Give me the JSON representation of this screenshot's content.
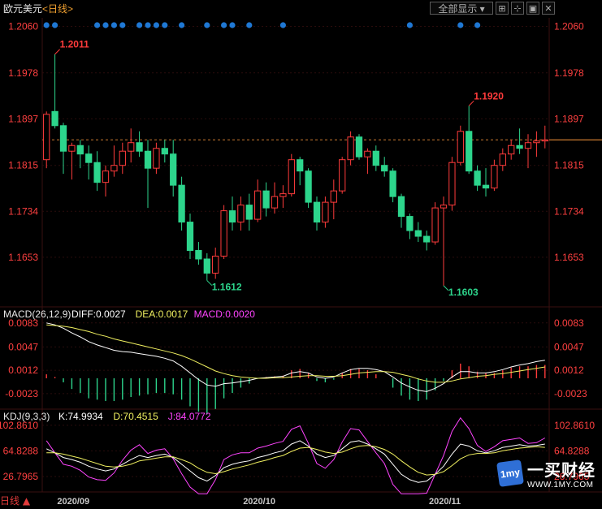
{
  "header": {
    "symbol": "欧元美元",
    "period": "<日线>",
    "period_button": "全部显示",
    "toolbar_icons": [
      "zoom-fit-icon",
      "crosshair-icon",
      "window-icon",
      "close-icon"
    ]
  },
  "corner_label": "日线",
  "watermark": {
    "brand_cn": "一买财经",
    "brand_en": "WWW.1MY.COM",
    "logo_text": "1my"
  },
  "colors": {
    "up": "#ff3b3b",
    "down": "#2dd58c",
    "grid": "#3a1010",
    "axis_text": "#ff4040",
    "diff_line": "#ffffff",
    "dea_line": "#f0f060",
    "macd_text": "#ff44ff",
    "dot": "#1f78d4",
    "price_line": "#ff9a3c"
  },
  "chart_data": [
    {
      "type": "candlestick",
      "panel": "price",
      "y_ticks": [
        "1.2060",
        "1.1978",
        "1.1897",
        "1.1815",
        "1.1734",
        "1.1653"
      ],
      "ylim": [
        1.1567,
        1.2075
      ],
      "x_tick_labels": [
        {
          "label": "2020/09",
          "index": 3
        },
        {
          "label": "2020/10",
          "index": 25
        },
        {
          "label": "2020/11",
          "index": 47
        }
      ],
      "current_price": 1.186,
      "annotations": [
        {
          "text": "1.2011",
          "index": 1,
          "value": 1.2011,
          "color": "up"
        },
        {
          "text": "1.1612",
          "index": 19,
          "value": 1.1612,
          "color": "down"
        },
        {
          "text": "1.1920",
          "index": 50,
          "value": 1.192,
          "color": "up"
        },
        {
          "text": "1.1603",
          "index": 47,
          "value": 1.1603,
          "color": "down"
        }
      ],
      "signal_dot_indices": [
        0,
        1,
        6,
        7,
        8,
        9,
        11,
        12,
        13,
        14,
        16,
        19,
        21,
        22,
        24,
        28,
        43,
        49,
        51
      ],
      "ohlc": [
        [
          1.1825,
          1.191,
          1.181,
          1.1905
        ],
        [
          1.191,
          1.2011,
          1.188,
          1.1885
        ],
        [
          1.1885,
          1.189,
          1.18,
          1.184
        ],
        [
          1.184,
          1.1855,
          1.179,
          1.185
        ],
        [
          1.185,
          1.186,
          1.181,
          1.1835
        ],
        [
          1.1835,
          1.185,
          1.179,
          1.182
        ],
        [
          1.182,
          1.184,
          1.177,
          1.1785
        ],
        [
          1.1785,
          1.1815,
          1.176,
          1.1805
        ],
        [
          1.1805,
          1.185,
          1.1795,
          1.1815
        ],
        [
          1.1815,
          1.1855,
          1.18,
          1.184
        ],
        [
          1.184,
          1.188,
          1.182,
          1.1855
        ],
        [
          1.1855,
          1.1875,
          1.183,
          1.184
        ],
        [
          1.184,
          1.186,
          1.174,
          1.181
        ],
        [
          1.181,
          1.1855,
          1.18,
          1.1845
        ],
        [
          1.1845,
          1.186,
          1.182,
          1.1835
        ],
        [
          1.1835,
          1.186,
          1.176,
          1.178
        ],
        [
          1.178,
          1.1795,
          1.17,
          1.1715
        ],
        [
          1.1715,
          1.173,
          1.165,
          1.1665
        ],
        [
          1.1665,
          1.168,
          1.164,
          1.165
        ],
        [
          1.165,
          1.166,
          1.1612,
          1.1625
        ],
        [
          1.1625,
          1.167,
          1.1615,
          1.1655
        ],
        [
          1.1655,
          1.1745,
          1.165,
          1.1735
        ],
        [
          1.1735,
          1.176,
          1.17,
          1.1715
        ],
        [
          1.1715,
          1.176,
          1.17,
          1.1745
        ],
        [
          1.1745,
          1.1765,
          1.17,
          1.172
        ],
        [
          1.172,
          1.179,
          1.1715,
          1.177
        ],
        [
          1.177,
          1.1785,
          1.1725,
          1.174
        ],
        [
          1.174,
          1.1785,
          1.173,
          1.176
        ],
        [
          1.176,
          1.178,
          1.174,
          1.1765
        ],
        [
          1.1765,
          1.1835,
          1.176,
          1.1825
        ],
        [
          1.1825,
          1.183,
          1.178,
          1.1805
        ],
        [
          1.1805,
          1.181,
          1.174,
          1.175
        ],
        [
          1.175,
          1.176,
          1.17,
          1.1715
        ],
        [
          1.1715,
          1.176,
          1.1705,
          1.175
        ],
        [
          1.175,
          1.179,
          1.172,
          1.177
        ],
        [
          1.177,
          1.183,
          1.1765,
          1.1825
        ],
        [
          1.1825,
          1.1875,
          1.1815,
          1.1865
        ],
        [
          1.1865,
          1.187,
          1.1825,
          1.183
        ],
        [
          1.183,
          1.1845,
          1.18,
          1.184
        ],
        [
          1.184,
          1.185,
          1.1805,
          1.1815
        ],
        [
          1.1815,
          1.183,
          1.1795,
          1.1805
        ],
        [
          1.1805,
          1.181,
          1.175,
          1.176
        ],
        [
          1.176,
          1.1765,
          1.1705,
          1.1725
        ],
        [
          1.1725,
          1.173,
          1.1685,
          1.17
        ],
        [
          1.17,
          1.1715,
          1.168,
          1.169
        ],
        [
          1.169,
          1.17,
          1.1665,
          1.168
        ],
        [
          1.168,
          1.175,
          1.1675,
          1.174
        ],
        [
          1.174,
          1.176,
          1.1603,
          1.1745
        ],
        [
          1.1745,
          1.183,
          1.1735,
          1.182
        ],
        [
          1.182,
          1.1885,
          1.1815,
          1.1875
        ],
        [
          1.1875,
          1.192,
          1.18,
          1.1805
        ],
        [
          1.1805,
          1.1815,
          1.177,
          1.178
        ],
        [
          1.178,
          1.181,
          1.176,
          1.1775
        ],
        [
          1.1775,
          1.1825,
          1.177,
          1.1815
        ],
        [
          1.1815,
          1.1845,
          1.1805,
          1.1835
        ],
        [
          1.1835,
          1.186,
          1.1825,
          1.185
        ],
        [
          1.185,
          1.188,
          1.1835,
          1.1845
        ],
        [
          1.1845,
          1.187,
          1.181,
          1.1855
        ],
        [
          1.1855,
          1.1875,
          1.183,
          1.1858
        ],
        [
          1.1858,
          1.1885,
          1.1845,
          1.186
        ]
      ]
    },
    {
      "type": "line",
      "panel": "macd",
      "title": "MACD(26,12,9)",
      "readouts": [
        {
          "label": "DIFF:0.0027",
          "color": "diff_line"
        },
        {
          "label": "DEA:0.0017",
          "color": "dea_line"
        },
        {
          "label": "MACD:0.0020",
          "color": "macd_text"
        }
      ],
      "y_ticks": [
        "0.0083",
        "0.0047",
        "0.0012",
        "-0.0023"
      ],
      "ylim": [
        -0.0045,
        0.009
      ],
      "diff": [
        0.0083,
        0.008,
        0.0075,
        0.0068,
        0.0062,
        0.0055,
        0.005,
        0.0046,
        0.0042,
        0.004,
        0.0039,
        0.0037,
        0.0035,
        0.0033,
        0.003,
        0.0026,
        0.0018,
        0.0008,
        -0.0002,
        -0.001,
        -0.0012,
        -0.0008,
        -0.0007,
        -0.0005,
        -0.0003,
        0.0,
        0.0001,
        0.0002,
        0.0003,
        0.0008,
        0.001,
        0.0008,
        0.0002,
        0.0,
        0.0002,
        0.0008,
        0.0013,
        0.0015,
        0.0015,
        0.0013,
        0.001,
        0.0002,
        -0.0007,
        -0.0013,
        -0.0018,
        -0.002,
        -0.0015,
        -0.0008,
        0.0002,
        0.001,
        0.001,
        0.0008,
        0.0008,
        0.001,
        0.0013,
        0.0017,
        0.002,
        0.0022,
        0.0025,
        0.0027
      ],
      "dea": [
        0.008,
        0.0079,
        0.0078,
        0.0076,
        0.0073,
        0.007,
        0.0066,
        0.0063,
        0.0059,
        0.0056,
        0.0053,
        0.005,
        0.0047,
        0.0044,
        0.0041,
        0.0038,
        0.0034,
        0.0029,
        0.0023,
        0.0017,
        0.0011,
        0.0007,
        0.0004,
        0.0002,
        0.0001,
        0.0,
        0.0,
        0.0001,
        0.0001,
        0.0002,
        0.0003,
        0.0004,
        0.0004,
        0.0003,
        0.0003,
        0.0004,
        0.0006,
        0.0008,
        0.0009,
        0.001,
        0.001,
        0.0009,
        0.0006,
        0.0003,
        -0.0001,
        -0.0004,
        -0.0006,
        -0.0006,
        -0.0004,
        -0.0001,
        0.0001,
        0.0003,
        0.0004,
        0.0006,
        0.0007,
        0.0009,
        0.0011,
        0.0013,
        0.0015,
        0.0017
      ],
      "histogram": [
        0.0006,
        0.0002,
        -0.0006,
        -0.0016,
        -0.0022,
        -0.003,
        -0.0032,
        -0.0034,
        -0.0034,
        -0.0032,
        -0.0028,
        -0.0026,
        -0.0024,
        -0.0022,
        -0.0022,
        -0.0024,
        -0.0032,
        -0.0042,
        -0.005,
        -0.0054,
        -0.0046,
        -0.003,
        -0.0022,
        -0.0014,
        -0.0008,
        -0.0001,
        0.0002,
        0.0003,
        0.0004,
        0.0012,
        0.0014,
        0.0008,
        -0.0004,
        -0.0006,
        -0.0002,
        0.0008,
        0.0014,
        0.0014,
        0.0012,
        0.0006,
        0.0,
        -0.0014,
        -0.0026,
        -0.0032,
        -0.0034,
        -0.0032,
        -0.0018,
        -0.0004,
        0.0012,
        0.0022,
        0.0018,
        0.001,
        0.0008,
        0.0008,
        0.0012,
        0.0016,
        0.0018,
        0.0018,
        0.002,
        0.002
      ]
    },
    {
      "type": "line",
      "panel": "kdj",
      "title": "KDJ(9,3,3)",
      "readouts": [
        {
          "label": "K:74.9934",
          "color": "diff_line"
        },
        {
          "label": "D:70.4515",
          "color": "dea_line"
        },
        {
          "label": "J:84.0772",
          "color": "macd_text"
        }
      ],
      "y_ticks": [
        "102.8610",
        "64.8288",
        "26.7965"
      ],
      "ylim": [
        5,
        110
      ],
      "k": [
        68,
        62,
        55,
        52,
        48,
        42,
        38,
        35,
        38,
        45,
        52,
        58,
        55,
        58,
        60,
        55,
        45,
        35,
        25,
        20,
        28,
        40,
        45,
        48,
        50,
        55,
        58,
        62,
        65,
        75,
        80,
        72,
        60,
        55,
        58,
        68,
        78,
        80,
        75,
        68,
        60,
        45,
        30,
        22,
        18,
        20,
        30,
        42,
        60,
        75,
        72,
        65,
        62,
        65,
        70,
        72,
        74,
        72,
        73,
        75
      ],
      "d": [
        62,
        62,
        60,
        57,
        54,
        50,
        46,
        42,
        41,
        42,
        45,
        50,
        52,
        54,
        56,
        56,
        52,
        47,
        39,
        33,
        31,
        34,
        38,
        41,
        44,
        48,
        51,
        55,
        58,
        64,
        69,
        70,
        67,
        63,
        61,
        63,
        68,
        72,
        73,
        71,
        67,
        60,
        50,
        41,
        33,
        29,
        30,
        34,
        43,
        53,
        59,
        61,
        61,
        62,
        65,
        67,
        69,
        70,
        71,
        70
      ],
      "j": [
        80,
        62,
        45,
        42,
        36,
        26,
        22,
        21,
        32,
        51,
        66,
        74,
        61,
        66,
        68,
        53,
        31,
        11,
        -3,
        -6,
        22,
        52,
        59,
        62,
        62,
        69,
        72,
        76,
        79,
        97,
        102,
        76,
        46,
        39,
        52,
        78,
        98,
        96,
        79,
        62,
        46,
        15,
        -10,
        -16,
        -12,
        2,
        30,
        58,
        94,
        119,
        98,
        73,
        64,
        71,
        80,
        82,
        84,
        76,
        77,
        84
      ]
    }
  ]
}
